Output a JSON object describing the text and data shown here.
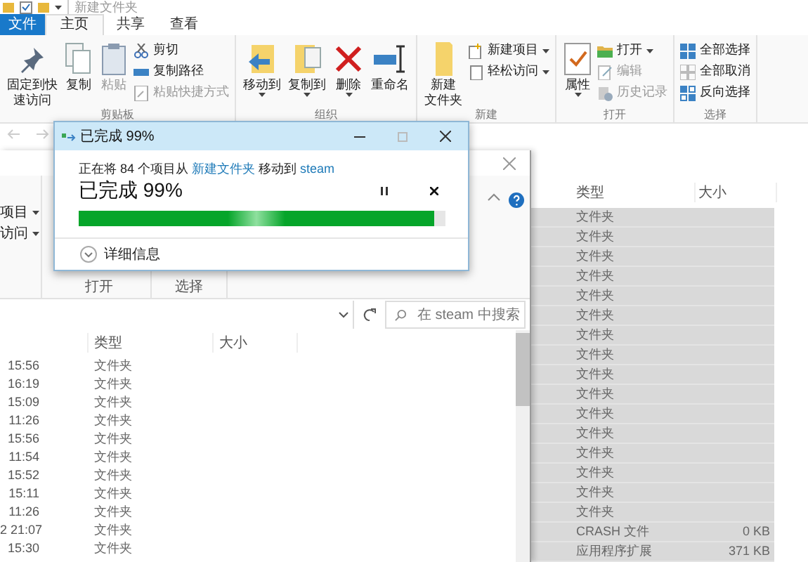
{
  "back_window": {
    "title": "新建文件夹",
    "tabs": [
      {
        "label": "文件",
        "kind": "file",
        "selected": false
      },
      {
        "label": "主页",
        "kind": "tab",
        "selected": true
      },
      {
        "label": "共享",
        "kind": "tab",
        "selected": false
      },
      {
        "label": "查看",
        "kind": "tab",
        "selected": false
      }
    ],
    "ribbon_groups": [
      {
        "label": "剪贴板",
        "items": [
          {
            "lines": [
              "固定到快",
              "速访问"
            ],
            "kind": "large",
            "disabled": false,
            "dropdown": false
          },
          {
            "lines": [
              "复制"
            ],
            "kind": "large",
            "disabled": false,
            "dropdown": false
          },
          {
            "lines": [
              "粘贴"
            ],
            "kind": "large",
            "disabled": true,
            "dropdown": false
          },
          {
            "label": "剪切",
            "kind": "small",
            "disabled": false,
            "dropdown": false
          },
          {
            "label": "复制路径",
            "kind": "small",
            "disabled": false,
            "dropdown": false
          },
          {
            "label": "粘贴快捷方式",
            "kind": "small",
            "disabled": true,
            "dropdown": false
          }
        ]
      },
      {
        "label": "组织",
        "items": [
          {
            "lines": [
              "移动到"
            ],
            "kind": "large",
            "disabled": false,
            "dropdown": true
          },
          {
            "lines": [
              "复制到"
            ],
            "kind": "large",
            "disabled": false,
            "dropdown": true
          },
          {
            "lines": [
              "删除"
            ],
            "kind": "large",
            "disabled": false,
            "dropdown": true
          },
          {
            "lines": [
              "重命名"
            ],
            "kind": "large",
            "disabled": false,
            "dropdown": false
          }
        ]
      },
      {
        "label": "新建",
        "items": [
          {
            "lines": [
              "新建",
              "文件夹"
            ],
            "kind": "large",
            "disabled": false,
            "dropdown": false
          },
          {
            "label": "新建项目",
            "kind": "small",
            "disabled": false,
            "dropdown": true
          },
          {
            "label": "轻松访问",
            "kind": "small",
            "disabled": false,
            "dropdown": true
          }
        ]
      },
      {
        "label": "打开",
        "items": [
          {
            "lines": [
              "属性"
            ],
            "kind": "large",
            "disabled": false,
            "dropdown": true
          },
          {
            "label": "打开",
            "kind": "small",
            "disabled": false,
            "dropdown": true
          },
          {
            "label": "编辑",
            "kind": "small",
            "disabled": true,
            "dropdown": false
          },
          {
            "label": "历史记录",
            "kind": "small",
            "disabled": true,
            "dropdown": false
          }
        ]
      },
      {
        "label": "选择",
        "items": [
          {
            "label": "全部选择",
            "kind": "small",
            "disabled": false,
            "dropdown": false
          },
          {
            "label": "全部取消",
            "kind": "small",
            "disabled": false,
            "dropdown": false
          },
          {
            "label": "反向选择",
            "kind": "small",
            "disabled": false,
            "dropdown": false
          }
        ]
      }
    ],
    "columns": [
      "类型",
      "大小"
    ],
    "rows": [
      {
        "type": "文件夹",
        "selected": true
      },
      {
        "type": "文件夹",
        "selected": true
      },
      {
        "type": "文件夹",
        "selected": true
      },
      {
        "type": "文件夹",
        "selected": true
      },
      {
        "type": "文件夹",
        "selected": true
      },
      {
        "type": "文件夹",
        "selected": true
      },
      {
        "type": "文件夹",
        "selected": true
      },
      {
        "type": "文件夹",
        "selected": true
      },
      {
        "type": "文件夹",
        "selected": true
      },
      {
        "type": "文件夹",
        "selected": true
      },
      {
        "type": "文件夹",
        "selected": true
      },
      {
        "type": "文件夹",
        "selected": true
      },
      {
        "type": "文件夹",
        "selected": true
      },
      {
        "type": "文件夹",
        "selected": true
      },
      {
        "type": "文件夹",
        "selected": true
      },
      {
        "type": "文件夹",
        "selected": true
      },
      {
        "type": "CRASH 文件",
        "size": "0 KB",
        "selected": true
      },
      {
        "type": "应用程序扩展",
        "size": "371 KB",
        "selected": true
      }
    ]
  },
  "front_window": {
    "ribbon_items": [
      {
        "label": "项目",
        "dropdown": true
      },
      {
        "label": "访问",
        "dropdown": true
      }
    ],
    "group_labels": [
      "打开",
      "选择"
    ],
    "search": {
      "placeholder": "在 steam 中搜索"
    },
    "columns": [
      "类型",
      "大小"
    ],
    "rows": [
      {
        "modified": "15:56",
        "type": "文件夹"
      },
      {
        "modified": "16:19",
        "type": "文件夹"
      },
      {
        "modified": "15:09",
        "type": "文件夹"
      },
      {
        "modified": "11:26",
        "type": "文件夹"
      },
      {
        "modified": "15:56",
        "type": "文件夹"
      },
      {
        "modified": "11:54",
        "type": "文件夹"
      },
      {
        "modified": "15:52",
        "type": "文件夹"
      },
      {
        "modified": "15:11",
        "type": "文件夹"
      },
      {
        "modified": "11:26",
        "type": "文件夹"
      },
      {
        "modified": "2 21:07",
        "type": "文件夹"
      },
      {
        "modified": "15:30",
        "type": "文件夹"
      }
    ]
  },
  "dialog": {
    "title": "已完成 99%",
    "message": [
      {
        "kind": "text",
        "text": "正在将 84 个项目从 "
      },
      {
        "kind": "link",
        "text": "新建文件夹"
      },
      {
        "kind": "text",
        "text": " 移动到 "
      },
      {
        "kind": "link",
        "text": "steam"
      }
    ],
    "status": "已完成 99%",
    "progress": {
      "level": 0.97
    },
    "details": {
      "label": "详细信息"
    }
  }
}
